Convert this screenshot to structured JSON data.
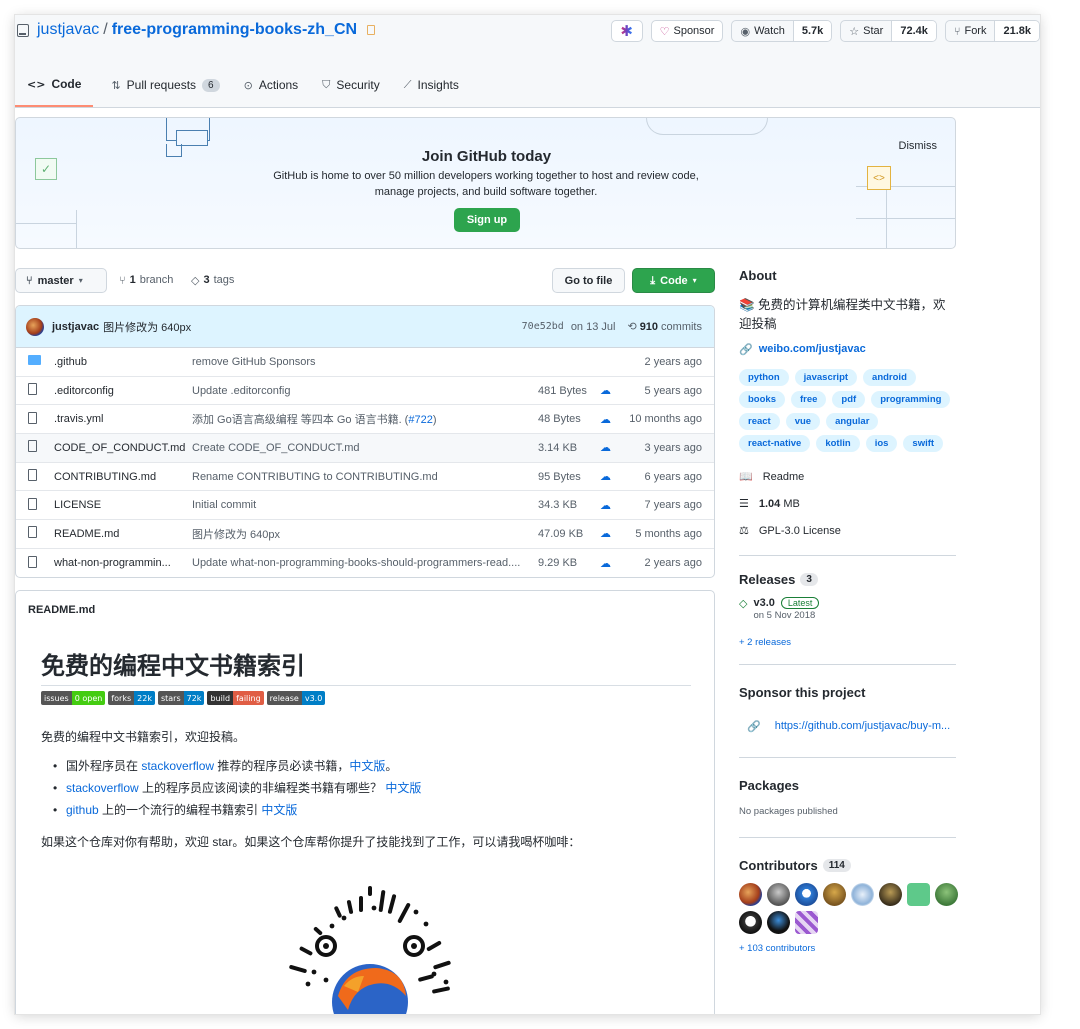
{
  "repo": {
    "owner": "justjavac",
    "name": "free-programming-books-zh_CN"
  },
  "header_buttons": {
    "sponsor_label": "Sponsor",
    "watch_label": "Watch",
    "watch_count": "5.7k",
    "star_label": "Star",
    "star_count": "72.4k",
    "fork_label": "Fork",
    "fork_count": "21.8k"
  },
  "tabs": [
    {
      "label": "Code",
      "icon": "code-icon"
    },
    {
      "label": "Pull requests",
      "icon": "pull-request-icon",
      "count": "6"
    },
    {
      "label": "Actions",
      "icon": "play-icon"
    },
    {
      "label": "Security",
      "icon": "shield-icon"
    },
    {
      "label": "Insights",
      "icon": "graph-icon"
    }
  ],
  "banner": {
    "title": "Join GitHub today",
    "line1": "GitHub is home to over 50 million developers working together to host and review code,",
    "line2": "manage projects, and build software together.",
    "signup": "Sign up",
    "dismiss": "Dismiss"
  },
  "branch_bar": {
    "branch": "master",
    "branch_count": "1",
    "branch_word": "branch",
    "tag_count": "3",
    "tag_word": "tags",
    "go_to_file": "Go to file",
    "code": "Code"
  },
  "commit": {
    "author": "justjavac",
    "message": "图片修改为 640px",
    "sha": "70e52bd",
    "date": "on 13 Jul",
    "commits_count": "910",
    "commits_word": "commits"
  },
  "files": [
    {
      "type": "folder",
      "name": ".github",
      "message": "remove GitHub Sponsors",
      "size": "",
      "age": "2 years ago"
    },
    {
      "type": "file",
      "name": ".editorconfig",
      "message": "Update .editorconfig",
      "size": "481 Bytes",
      "age": "5 years ago"
    },
    {
      "type": "file",
      "name": ".travis.yml",
      "message": "添加 Go语言高级编程 等四本 Go 语言书籍. (",
      "link": "#722",
      "message_end": ")",
      "size": "48 Bytes",
      "age": "10 months ago"
    },
    {
      "type": "file",
      "name": "CODE_OF_CONDUCT.md",
      "message": "Create CODE_OF_CONDUCT.md",
      "size": "3.14 KB",
      "age": "3 years ago"
    },
    {
      "type": "file",
      "name": "CONTRIBUTING.md",
      "message": "Rename CONTRIBUTING to CONTRIBUTING.md",
      "size": "95 Bytes",
      "age": "6 years ago"
    },
    {
      "type": "file",
      "name": "LICENSE",
      "message": "Initial commit",
      "size": "34.3 KB",
      "age": "7 years ago"
    },
    {
      "type": "file",
      "name": "README.md",
      "message": "图片修改为 640px",
      "size": "47.09 KB",
      "age": "5 months ago"
    },
    {
      "type": "file",
      "name": "what-non-programmin...",
      "message": "Update what-non-programming-books-should-programmers-read....",
      "size": "9.29 KB",
      "age": "2 years ago"
    }
  ],
  "readme": {
    "filename": "README.md",
    "title": "免费的编程中文书籍索引",
    "shields": [
      {
        "k": "issues",
        "v": "0 open",
        "color": "#4c1"
      },
      {
        "k": "forks",
        "v": "22k",
        "color": "#007ec6"
      },
      {
        "k": "stars",
        "v": "72k",
        "color": "#007ec6"
      },
      {
        "k": "build",
        "v": "failing",
        "color": "#e05d44"
      },
      {
        "k": "release",
        "v": "v3.0",
        "color": "#007ec6"
      }
    ],
    "intro": "免费的编程中文书籍索引，欢迎投稿。",
    "items": [
      {
        "pre": "国外程序员在 ",
        "link1": "stackoverflow",
        "mid": " 推荐的程序员必读书籍，",
        "link2": "中文版",
        "post": "。"
      },
      {
        "pre": "",
        "link1": "stackoverflow",
        "mid": " 上的程序员应该阅读的非编程类书籍有哪些？ ",
        "link2": "中文版",
        "post": ""
      },
      {
        "pre": "",
        "link1": "github",
        "mid": " 上的一个流行的编程书籍索引 ",
        "link2": "中文版",
        "post": ""
      }
    ],
    "outro": "如果这个仓库对你有帮助，欢迎 star。如果这个仓库帮你提升了技能找到了工作，可以请我喝杯咖啡："
  },
  "about": {
    "heading": "About",
    "description": "📚 免费的计算机编程类中文书籍，欢迎投稿",
    "website": "weibo.com/justjavac",
    "topics": [
      "python",
      "javascript",
      "android",
      "books",
      "free",
      "pdf",
      "programming",
      "react",
      "vue",
      "angular",
      "react-native",
      "kotlin",
      "ios",
      "swift"
    ],
    "readme": "Readme",
    "size_value": "1.04",
    "size_unit": "MB",
    "license": "GPL-3.0 License"
  },
  "releases": {
    "heading": "Releases",
    "count": "3",
    "tag": "v3.0",
    "latest": "Latest",
    "date": "on 5 Nov 2018",
    "more": "+ 2 releases"
  },
  "sponsor": {
    "heading": "Sponsor this project",
    "link": "https://github.com/justjavac/buy-m..."
  },
  "packages": {
    "heading": "Packages",
    "text": "No packages published"
  },
  "contributors": {
    "heading": "Contributors",
    "count": "114",
    "more": "+ 103 contributors"
  },
  "colors": {
    "link": "#0969da",
    "green": "#2da44e",
    "tab_underline": "#fd8c73"
  }
}
